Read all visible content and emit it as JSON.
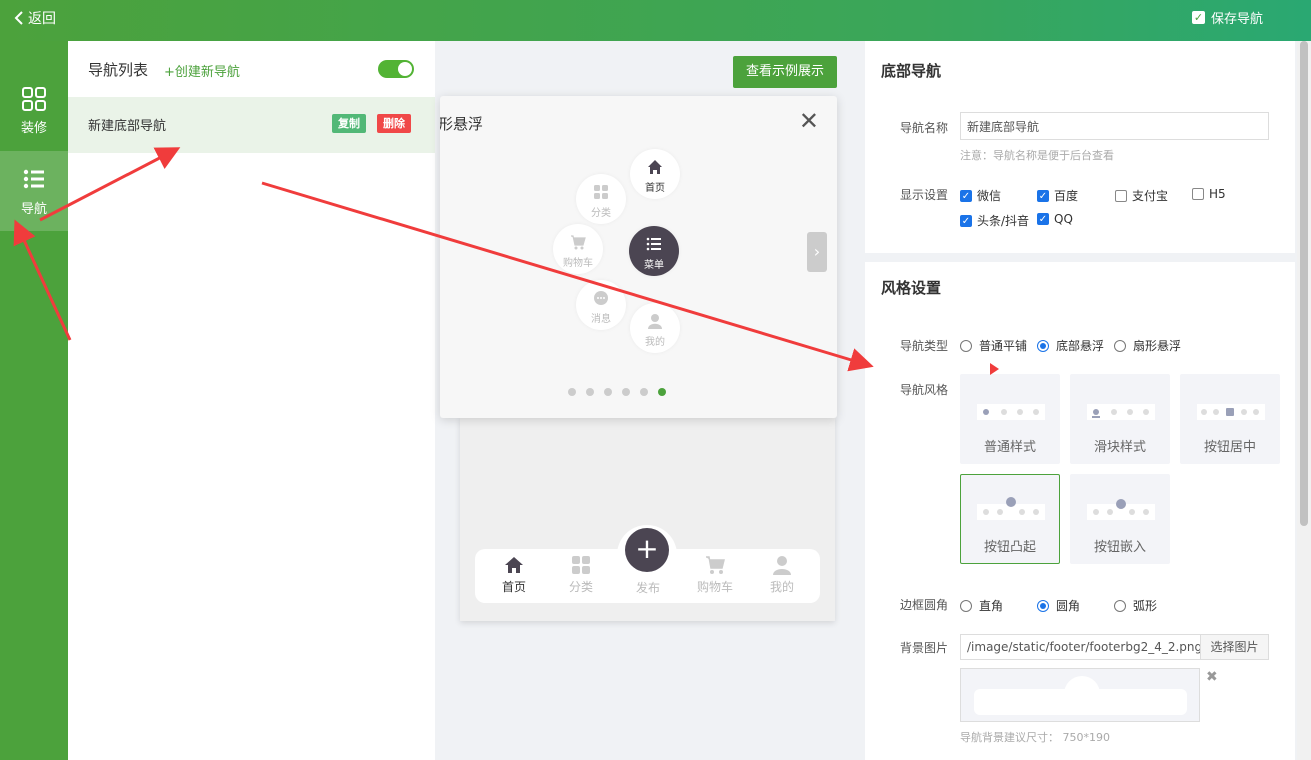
{
  "topbar": {
    "back_label": "返回",
    "save_label": "保存导航"
  },
  "sidebar": {
    "items": [
      {
        "label": "装修",
        "icon": "grid-icon"
      },
      {
        "label": "导航",
        "icon": "list-icon",
        "active": true
      }
    ]
  },
  "nav_list": {
    "title": "导航列表",
    "create_label": "+创建新导航",
    "toggle_on": true,
    "rows": [
      {
        "name": "新建底部导航",
        "copy_label": "复制",
        "delete_label": "删除"
      }
    ]
  },
  "preview": {
    "example_label": "查看示例展示",
    "popup_title": "形悬浮",
    "fan_items": {
      "home": "首页",
      "category": "分类",
      "cart": "购物车",
      "menu": "菜单",
      "message": "消息",
      "mine": "我的"
    },
    "slide_count": 6,
    "active_slide": 6,
    "tabbar": {
      "home": "首页",
      "category": "分类",
      "publish": "发布",
      "cart": "购物车",
      "mine": "我的"
    }
  },
  "settings": {
    "bottom_nav": {
      "title": "底部导航",
      "name_label": "导航名称",
      "name_value": "新建底部导航",
      "name_hint": "注意：导航名称是便于后台查看",
      "display_label": "显示设置",
      "platforms": [
        {
          "label": "微信",
          "checked": true
        },
        {
          "label": "百度",
          "checked": true
        },
        {
          "label": "支付宝",
          "checked": false
        },
        {
          "label": "H5",
          "checked": false
        },
        {
          "label": "头条/抖音",
          "checked": true
        },
        {
          "label": "QQ",
          "checked": true
        }
      ]
    },
    "style": {
      "title": "风格设置",
      "type_label": "导航类型",
      "types": [
        {
          "label": "普通平铺",
          "checked": false
        },
        {
          "label": "底部悬浮",
          "checked": true
        },
        {
          "label": "扇形悬浮",
          "checked": false
        }
      ],
      "style_label": "导航风格",
      "styles": [
        "普通样式",
        "滑块样式",
        "按钮居中",
        "按钮凸起",
        "按钮嵌入"
      ],
      "selected_style": "按钮凸起",
      "corner_label": "边框圆角",
      "corners": [
        {
          "label": "直角",
          "checked": false
        },
        {
          "label": "圆角",
          "checked": true
        },
        {
          "label": "弧形",
          "checked": false
        }
      ],
      "bg_label": "背景图片",
      "bg_path": "/image/static/footer/footerbg2_4_2.png",
      "pick_label": "选择图片",
      "bg_hint": "导航背景建议尺寸：  750*190"
    }
  },
  "colors": {
    "brand": "#4ca23c",
    "danger": "#f04848",
    "copy": "#52b877",
    "annotation": "#f03c3c"
  }
}
